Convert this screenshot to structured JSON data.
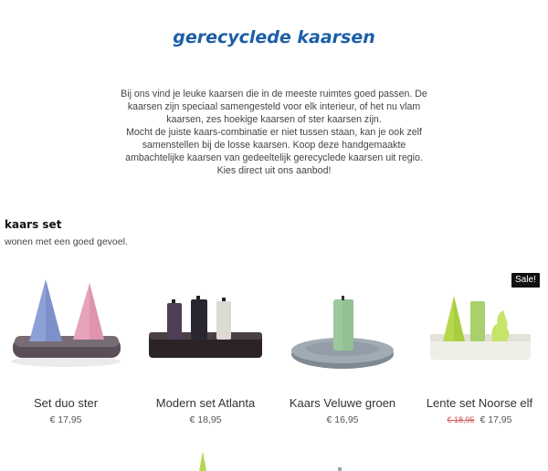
{
  "header": {
    "title": "gerecyclede kaarsen"
  },
  "intro": {
    "lines": [
      "Bij ons vind je leuke kaarsen die in de meeste ruimtes goed passen. De",
      "kaarsen zijn speciaal samengesteld voor elk interieur, of het nu vlam",
      "kaarsen, zes hoekige kaarsen of ster kaarsen zijn.",
      "Mocht de juiste kaars-combinatie er niet tussen staan, kan je ook zelf",
      "samenstellen bij de losse kaarsen. Koop deze handgemaakte",
      "ambachtelijke kaarsen van gedeeltelijk gerecyclede kaarsen uit  regio.",
      "Kies direct uit ons aanbod!"
    ]
  },
  "section": {
    "title": "kaars set",
    "subtitle": "wonen met een goed gevoel."
  },
  "products": [
    {
      "name": "Set duo ster",
      "price": "€ 17,95",
      "image": "two-star-candles-on-dark-tray",
      "colors": {
        "candle1": "#8ea1d6",
        "candle2": "#e6a3bb",
        "tray": "#5a4f58"
      }
    },
    {
      "name": "Modern set Atlanta",
      "price": "€ 18,95",
      "image": "three-pillar-candles-on-dark-tray",
      "colors": {
        "candle1": "#4e3f57",
        "candle2": "#2b2730",
        "candle3": "#dcdad3",
        "tray": "#2b2325"
      }
    },
    {
      "name": "Kaars Veluwe groen",
      "price": "€ 16,95",
      "image": "green-pillar-on-grey-plate",
      "colors": {
        "candle1": "#9ec79e",
        "tray": "#7f8994"
      }
    },
    {
      "name": "Lente set Noorse elf",
      "old_price": "€ 18,95",
      "price": "€ 17,95",
      "badge": "Sale!",
      "image": "lime-candles-on-white-tray",
      "colors": {
        "candle1": "#b6d84c",
        "candle2": "#a9d06b",
        "tray": "#efefe6"
      }
    }
  ]
}
